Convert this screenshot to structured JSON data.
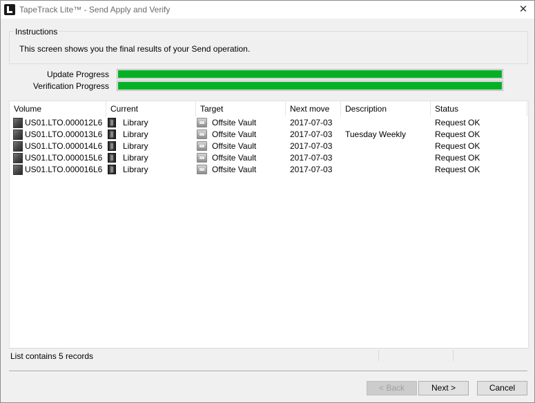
{
  "window": {
    "title": "TapeTrack Lite™ - Send Apply and Verify",
    "close_symbol": "✕"
  },
  "instructions": {
    "legend": "Instructions",
    "text": "This screen shows you the final results of your Send operation."
  },
  "progress": {
    "update_label": "Update Progress",
    "update_value": 1.0,
    "verification_label": "Verification Progress",
    "verification_value": 1.0,
    "fill_color": "#06b025"
  },
  "table": {
    "columns": [
      "Volume",
      "Current",
      "Target",
      "Next move",
      "Description",
      "Status"
    ],
    "rows": [
      {
        "volume": "US01.LTO.000012L6",
        "current": "Library",
        "target": "Offsite Vault",
        "next_move": "2017-07-03",
        "description": "",
        "status": "Request OK"
      },
      {
        "volume": "US01.LTO.000013L6",
        "current": "Library",
        "target": "Offsite Vault",
        "next_move": "2017-07-03",
        "description": "Tuesday Weekly",
        "status": "Request OK"
      },
      {
        "volume": "US01.LTO.000014L6",
        "current": "Library",
        "target": "Offsite Vault",
        "next_move": "2017-07-03",
        "description": "",
        "status": "Request OK"
      },
      {
        "volume": "US01.LTO.000015L6",
        "current": "Library",
        "target": "Offsite Vault",
        "next_move": "2017-07-03",
        "description": "",
        "status": "Request OK"
      },
      {
        "volume": "US01.LTO.000016L6",
        "current": "Library",
        "target": "Offsite Vault",
        "next_move": "2017-07-03",
        "description": "",
        "status": "Request OK"
      }
    ],
    "icons": {
      "volume": "tape-icon",
      "current": "library-icon",
      "target": "vault-icon"
    }
  },
  "statusbar": {
    "text": "List contains 5 records"
  },
  "buttons": {
    "back": "< Back",
    "next": "Next >",
    "cancel": "Cancel"
  }
}
